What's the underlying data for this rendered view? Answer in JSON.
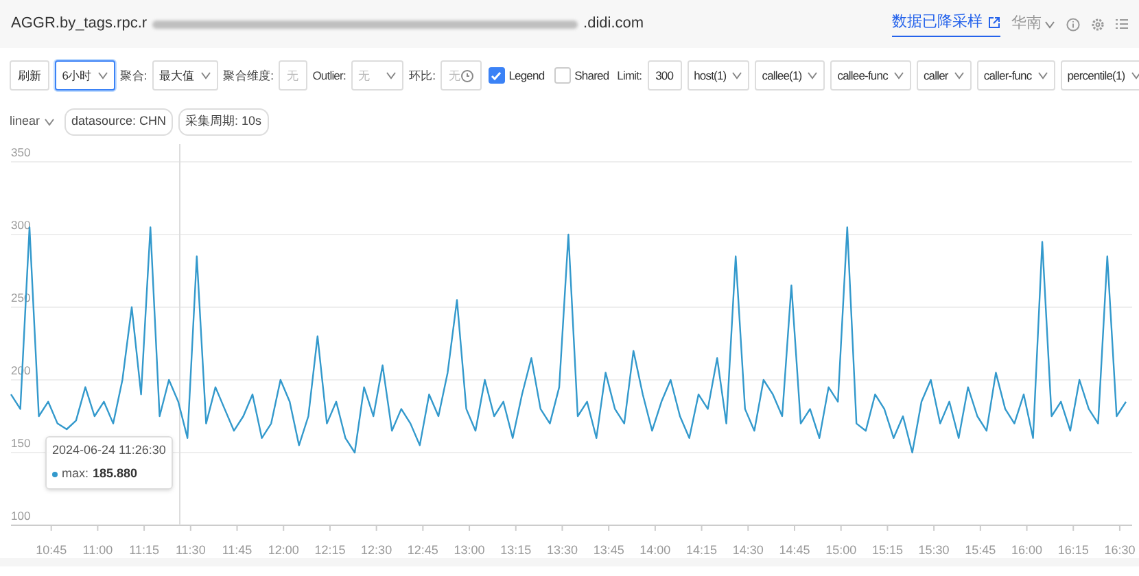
{
  "header": {
    "title_prefix": "AGGR.by_tags.rpc.r",
    "title_suffix": ".didi.com",
    "sampling_link": "数据已降采样",
    "region": "华南"
  },
  "toolbar": [
    {
      "kind": "button",
      "label": "刷新"
    },
    {
      "kind": "select",
      "value": "6小时",
      "focused": true
    },
    {
      "kind": "label",
      "text": "聚合:"
    },
    {
      "kind": "select",
      "value": "最大值",
      "focused": false
    },
    {
      "kind": "label",
      "text": "聚合维度:"
    },
    {
      "kind": "input",
      "placeholder": "无"
    },
    {
      "kind": "label",
      "text": "Outlier:"
    },
    {
      "kind": "select",
      "placeholder": "无",
      "focused": false
    },
    {
      "kind": "label",
      "text": "环比:"
    },
    {
      "kind": "input",
      "placeholder": "无",
      "icon": true
    },
    {
      "kind": "checkbox",
      "label": "Legend",
      "checked": true
    },
    {
      "kind": "checkbox",
      "label": "Shared",
      "checked": false
    },
    {
      "kind": "label",
      "text": "Limit:"
    },
    {
      "kind": "input",
      "value": "300"
    },
    {
      "kind": "select",
      "value": "host(1)",
      "focused": false
    },
    {
      "kind": "select",
      "value": "callee(1)",
      "focused": false
    },
    {
      "kind": "select",
      "value": "callee-func",
      "focused": false
    },
    {
      "kind": "select",
      "value": "caller",
      "focused": false
    },
    {
      "kind": "select",
      "value": "caller-func",
      "focused": false
    },
    {
      "kind": "select",
      "value": "percentile(1)",
      "focused": false
    }
  ],
  "options": {
    "scale": "linear",
    "tags": [
      "datasource: CHN",
      "采集周期: 10s"
    ]
  },
  "chart": {
    "tooltip": {
      "time": "2024-06-24 11:26:30",
      "separator": ":",
      "value": "185.880"
    },
    "chart_data": {
      "type": "line",
      "grid": true,
      "ref_lines": [
        {
          "axis": "x",
          "value": 686.5
        }
      ],
      "xlim": [
        632,
        994
      ],
      "ylim": [
        100,
        350
      ],
      "yticks": [
        100,
        150,
        200,
        250,
        300,
        350
      ],
      "xticks": [
        {
          "value": 645,
          "label": "10:45"
        },
        {
          "value": 660,
          "label": "11:00"
        },
        {
          "value": 675,
          "label": "11:15"
        },
        {
          "value": 690,
          "label": "11:30"
        },
        {
          "value": 705,
          "label": "11:45"
        },
        {
          "value": 720,
          "label": "12:00"
        },
        {
          "value": 735,
          "label": "12:15"
        },
        {
          "value": 750,
          "label": "12:30"
        },
        {
          "value": 765,
          "label": "12:45"
        },
        {
          "value": 780,
          "label": "13:00"
        },
        {
          "value": 795,
          "label": "13:15"
        },
        {
          "value": 810,
          "label": "13:30"
        },
        {
          "value": 825,
          "label": "13:45"
        },
        {
          "value": 840,
          "label": "14:00"
        },
        {
          "value": 855,
          "label": "14:15"
        },
        {
          "value": 870,
          "label": "14:30"
        },
        {
          "value": 885,
          "label": "14:45"
        },
        {
          "value": 900,
          "label": "15:00"
        },
        {
          "value": 915,
          "label": "15:15"
        },
        {
          "value": 930,
          "label": "15:30"
        },
        {
          "value": 945,
          "label": "15:45"
        },
        {
          "value": 960,
          "label": "16:00"
        },
        {
          "value": 975,
          "label": "16:15"
        },
        {
          "value": 990,
          "label": "16:30"
        }
      ],
      "x": [
        632,
        635,
        638,
        641,
        644,
        647,
        650,
        653,
        656,
        659,
        662,
        665,
        668,
        671,
        674,
        677,
        680,
        683,
        686,
        689,
        692,
        695,
        698,
        701,
        704,
        707,
        710,
        713,
        716,
        719,
        722,
        725,
        728,
        731,
        734,
        737,
        740,
        743,
        746,
        749,
        752,
        755,
        758,
        761,
        764,
        767,
        770,
        773,
        776,
        779,
        782,
        785,
        788,
        791,
        794,
        797,
        800,
        803,
        806,
        809,
        812,
        815,
        818,
        821,
        824,
        827,
        830,
        833,
        836,
        839,
        842,
        845,
        848,
        851,
        854,
        857,
        860,
        863,
        866,
        869,
        872,
        875,
        878,
        881,
        884,
        887,
        890,
        893,
        896,
        899,
        902,
        905,
        908,
        911,
        914,
        917,
        920,
        923,
        926,
        929,
        932,
        935,
        938,
        941,
        944,
        947,
        950,
        953,
        956,
        959,
        962,
        965,
        968,
        971,
        974,
        977,
        980,
        983,
        986,
        989,
        992
      ],
      "series": [
        {
          "name": "max",
          "color": "#3399cc",
          "values": [
            190,
            180,
            305,
            175,
            185,
            170,
            166,
            172,
            195,
            175,
            185,
            170,
            200,
            250,
            190,
            305,
            175,
            200,
            185,
            160,
            285,
            170,
            195,
            180,
            165,
            175,
            190,
            160,
            170,
            200,
            185,
            155,
            175,
            230,
            170,
            185,
            160,
            150,
            195,
            175,
            210,
            165,
            180,
            170,
            155,
            190,
            175,
            205,
            255,
            180,
            165,
            200,
            175,
            185,
            160,
            190,
            215,
            180,
            170,
            195,
            300,
            175,
            185,
            160,
            205,
            180,
            170,
            220,
            190,
            165,
            185,
            200,
            175,
            160,
            190,
            180,
            215,
            170,
            285,
            180,
            165,
            200,
            190,
            175,
            265,
            170,
            180,
            160,
            195,
            185,
            305,
            170,
            165,
            190,
            180,
            160,
            175,
            150,
            185,
            200,
            170,
            185,
            160,
            195,
            175,
            165,
            205,
            180,
            170,
            190,
            160,
            295,
            175,
            185,
            165,
            200,
            180,
            170,
            285,
            175,
            185
          ]
        }
      ]
    }
  }
}
